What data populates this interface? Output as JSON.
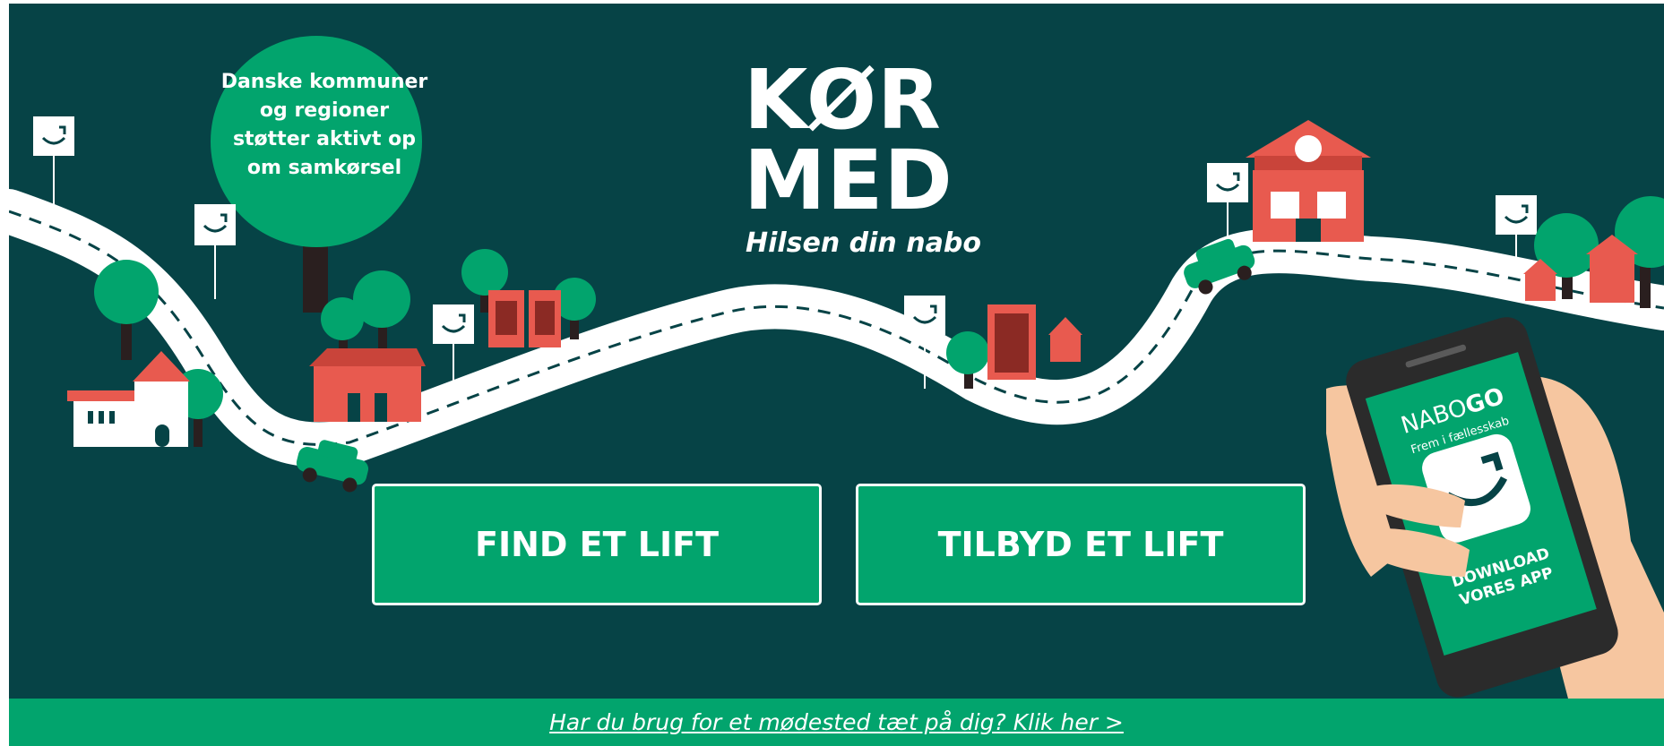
{
  "logo": {
    "line1": "KØR",
    "line2": "MED",
    "tagline": "Hilsen din nabo"
  },
  "info_bubble": {
    "text": "Danske kommuner og regioner støtter aktivt op om samkørsel"
  },
  "buttons": {
    "find_lift": "FIND ET LIFT",
    "offer_lift": "TILBYD ET LIFT"
  },
  "phone": {
    "brand_light": "NABO",
    "brand_bold": "GO",
    "subtitle": "Frem i fællesskab",
    "download_line1": "DOWNLOAD",
    "download_line2": "VORES APP"
  },
  "footer": {
    "link_text": "Har du brug for et mødested tæt på dig? Klik her >"
  },
  "colors": {
    "background": "#064346",
    "accent_green": "#02a46d",
    "tree_green": "#02a46d",
    "house_red": "#e85a4f",
    "road": "#ffffff"
  }
}
